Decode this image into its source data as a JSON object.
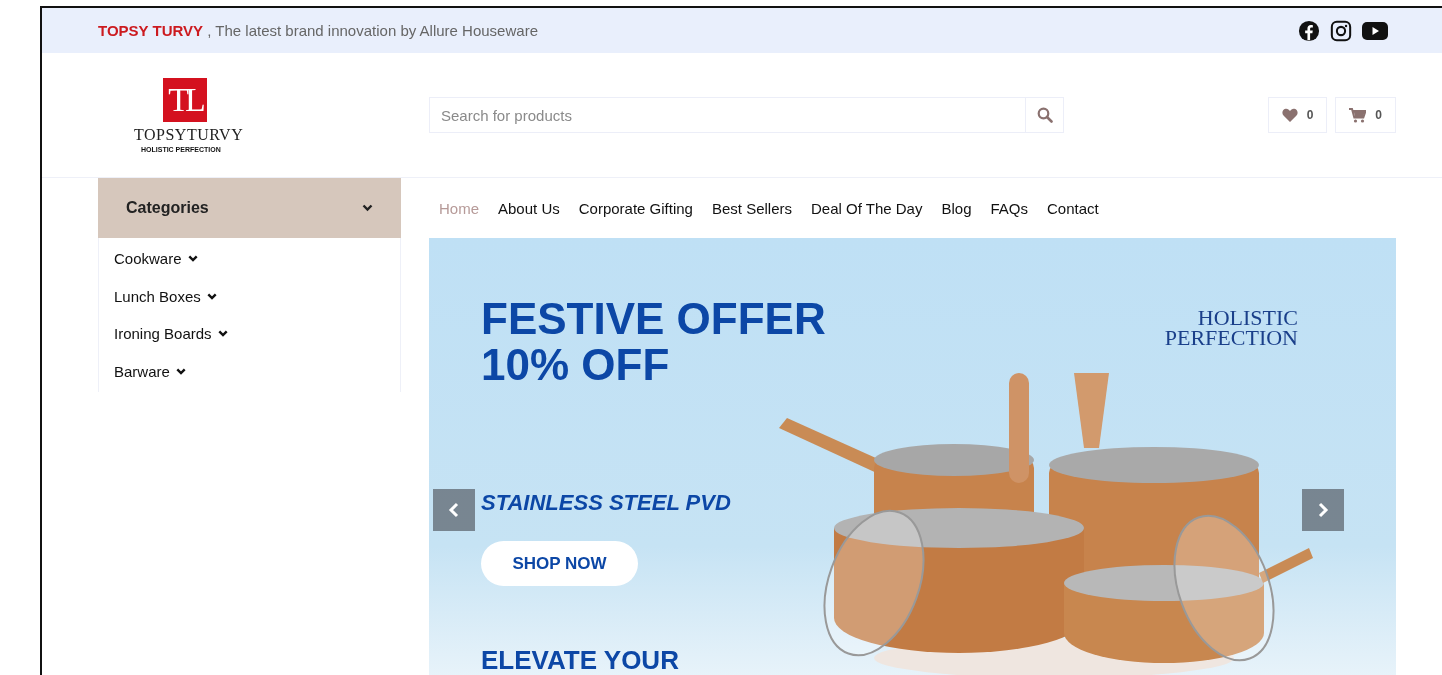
{
  "top_bar": {
    "brand": "TOPSY TURVY",
    "tagline": ", The latest brand innovation by Allure Houseware"
  },
  "logo": {
    "monogram": "TL",
    "name": "TOPSYTURVY",
    "slogan": "HOLISTIC PERFECTION"
  },
  "search": {
    "placeholder": "Search for products"
  },
  "wishlist": {
    "count": "0"
  },
  "cart": {
    "count": "0"
  },
  "categories": {
    "title": "Categories",
    "items": [
      {
        "label": "Cookware"
      },
      {
        "label": "Lunch Boxes"
      },
      {
        "label": "Ironing Boards"
      },
      {
        "label": "Barware"
      }
    ]
  },
  "nav": [
    {
      "label": "Home",
      "selected": true
    },
    {
      "label": "About Us",
      "selected": false
    },
    {
      "label": "Corporate Gifting",
      "selected": false
    },
    {
      "label": "Best Sellers",
      "selected": false
    },
    {
      "label": "Deal Of The Day",
      "selected": false
    },
    {
      "label": "Blog",
      "selected": false
    },
    {
      "label": "FAQs",
      "selected": false
    },
    {
      "label": "Contact",
      "selected": false
    }
  ],
  "hero": {
    "headline": [
      "FESTIVE OFFER",
      "10% OFF"
    ],
    "badge": [
      "HOLISTIC",
      "PERFECTION"
    ],
    "subtitle": "STAINLESS STEEL PVD",
    "button": "SHOP NOW",
    "next_heading": "ELEVATE YOUR"
  }
}
